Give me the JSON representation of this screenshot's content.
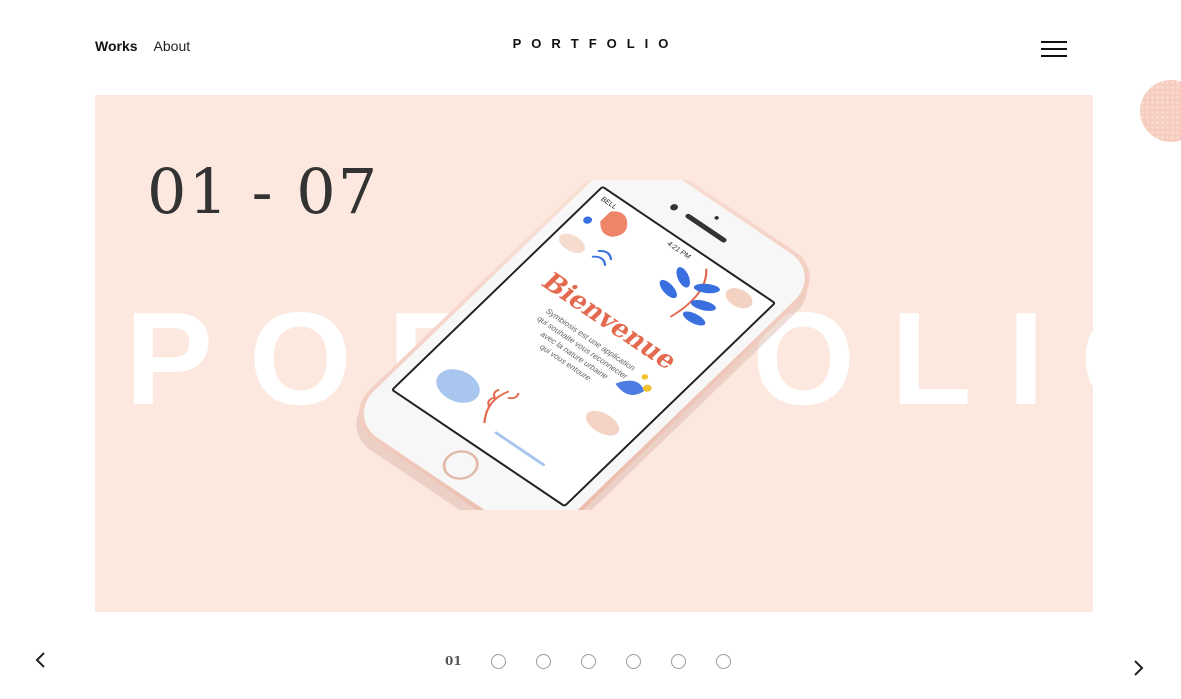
{
  "nav": {
    "works_label": "Works",
    "about_label": "About",
    "brand": "PORTFOLIO",
    "menu_icon": "hamburger-icon"
  },
  "hero": {
    "background_word": "PORTFOLIO",
    "counter": "01 - 07",
    "accent_color": "#fde8df",
    "phone_screen": {
      "status_carrier": "BELL",
      "status_time": "4:21 PM",
      "title": "Bienvenue",
      "body": [
        "Symbiosis est une application",
        "qui souhaite vous reconnecter",
        "avec la nature urbaine",
        "qui vous entoure."
      ]
    }
  },
  "slider": {
    "current": "01",
    "total_slides": 7,
    "prev_icon": "chevron-left-icon",
    "next_icon": "chevron-right-icon"
  }
}
